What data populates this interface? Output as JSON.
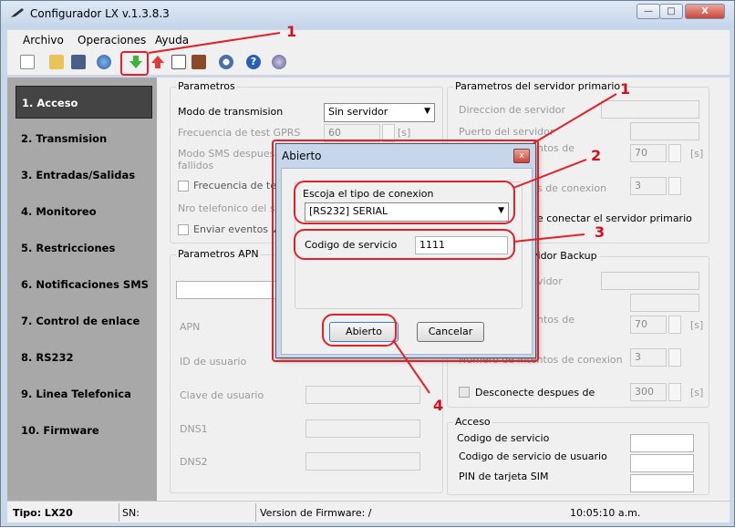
{
  "window": {
    "title": "Configurador LX v.1.3.8.3",
    "minimize": "—",
    "maximize": "□",
    "close": "X"
  },
  "menu": [
    "Archivo",
    "Operaciones",
    "Ayuda"
  ],
  "sidebar": {
    "items": [
      {
        "label": "1. Acceso",
        "active": true
      },
      {
        "label": "2. Transmision"
      },
      {
        "label": "3. Entradas/Salidas"
      },
      {
        "label": "4. Monitoreo"
      },
      {
        "label": "5. Restricciones"
      },
      {
        "label": "6. Notificaciones SMS"
      },
      {
        "label": "7. Control de enlace"
      },
      {
        "label": "8. RS232"
      },
      {
        "label": "9. Linea Telefonica"
      },
      {
        "label": "10. Firmware"
      }
    ]
  },
  "parametros": {
    "title": "Parametros",
    "modo_label": "Modo de transmision",
    "modo_value": "Sin servidor",
    "frecuencia_gprs_label": "Frecuencia de test GPRS",
    "frecuencia_gprs_value": "60",
    "frecuencia_unit": "[s]",
    "modo_sms_label_1": "Modo SMS despues de",
    "modo_sms_label_2": "fallidos",
    "frecuencia_test_label": "Frecuencia de test",
    "nro_telefonico_label": "Nro telefonico del serv",
    "enviar_eventos_label": "Enviar eventos via"
  },
  "apn": {
    "title": "Parametros APN",
    "apn_label": "APN",
    "usuario_label": "ID de usuario",
    "clave_label": "Clave de usuario",
    "dns1_label": "DNS1",
    "dns2_label": "DNS2"
  },
  "primario": {
    "title": "Parametros del servidor primario",
    "direccion_label": "Direccion de servidor",
    "puerto_label": "Puerto del servidor",
    "intentos_label": "ntos de",
    "intentos_value": "70",
    "unit": "[s]",
    "conexion_label": "s de conexion",
    "conexion_value": "3",
    "conectar_label": "e conectar el servidor primario"
  },
  "backup": {
    "title": "vidor Backup",
    "servidor_label": "vidor",
    "intentos_label": "ntos de",
    "intentos_value": "70",
    "unit": "[s]",
    "conexion_label": "Numero de intentos de conexion",
    "conexion_value": "3",
    "desconecte_label": "Desconecte despues de",
    "desconecte_value": "300",
    "desconecte_unit": "[s]"
  },
  "acceso": {
    "title": "Acceso",
    "codigo_label": "Codigo de servicio",
    "codigo_usuario_label": "Codigo de servicio de usuario",
    "pin_label": "PIN de tarjeta SIM"
  },
  "status": {
    "tipo": "Tipo: LX20",
    "sn": "SN:",
    "firmware": "Version de Firmware: /",
    "time": "10:05:10 a.m."
  },
  "dialog": {
    "title": "Abierto",
    "close": "x",
    "conexion_label": "Escoja el tipo de conexion",
    "conexion_value": "[RS232] SERIAL",
    "codigo_label": "Codigo de servicio",
    "codigo_value": "1111",
    "ok": "Abierto",
    "cancel": "Cancelar"
  },
  "annotations": [
    "1",
    "1",
    "2",
    "3",
    "4"
  ],
  "colors": {
    "annotation": "#e0202a",
    "sidebar": "#a8a8a8",
    "active_nav": "#444444"
  }
}
